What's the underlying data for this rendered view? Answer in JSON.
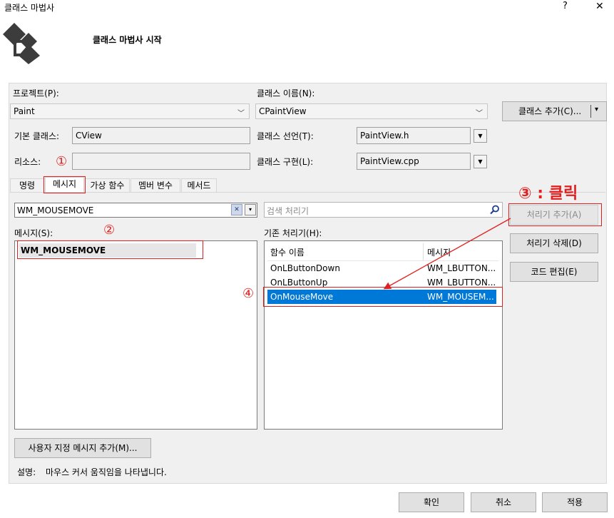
{
  "window": {
    "title": "클래스 마법사",
    "help": "?",
    "close": "✕"
  },
  "header": {
    "title": "클래스 마법사 시작"
  },
  "project": {
    "label": "프로젝트(P):",
    "value": "Paint"
  },
  "class_name": {
    "label": "클래스 이름(N):",
    "value": "CPaintView"
  },
  "add_class_button": {
    "label": "클래스 추가(C)...",
    "arrow": "▾"
  },
  "base_class": {
    "label": "기본 클래스:",
    "value": "CView"
  },
  "resource": {
    "label": "리소스:",
    "value": ""
  },
  "class_decl": {
    "label": "클래스 선언(T):",
    "value": "PaintView.h"
  },
  "class_impl": {
    "label": "클래스 구현(L):",
    "value": "PaintView.cpp"
  },
  "tabs": [
    "명령",
    "메시지",
    "가상 함수",
    "멤버 변수",
    "메서드"
  ],
  "filter": {
    "value": "WM_MOUSEMOVE",
    "clear": "✕",
    "arrow": "▾"
  },
  "search": {
    "placeholder": "검색 처리기"
  },
  "messages": {
    "label": "메시지(S):",
    "items": [
      "WM_MOUSEMOVE"
    ]
  },
  "handlers": {
    "label": "기존 처리기(H):",
    "columns": [
      "함수 이름",
      "메시지"
    ],
    "rows": [
      {
        "name": "OnLButtonDown",
        "message": "WM_LBUTTON..."
      },
      {
        "name": "OnLButtonUp",
        "message": "WM_LBUTTON..."
      },
      {
        "name": "OnMouseMove",
        "message": "WM_MOUSEM..."
      }
    ]
  },
  "buttons": {
    "add_handler": "처리기 추가(A)",
    "delete_handler": "처리기 삭제(D)",
    "edit_code": "코드 편집(E)",
    "custom_message": "사용자 지정 메시지 추가(M)...",
    "ok": "확인",
    "cancel": "취소",
    "apply": "적용"
  },
  "description": {
    "label": "설명:",
    "text": "마우스 커서 움직임을 나타냅니다."
  },
  "annotations": {
    "a1": "①",
    "a2": "②",
    "a3": "③ : 클릭",
    "a4": "④"
  },
  "colors": {
    "annotation_red": "#e02020",
    "selection_blue": "#0078d7"
  }
}
